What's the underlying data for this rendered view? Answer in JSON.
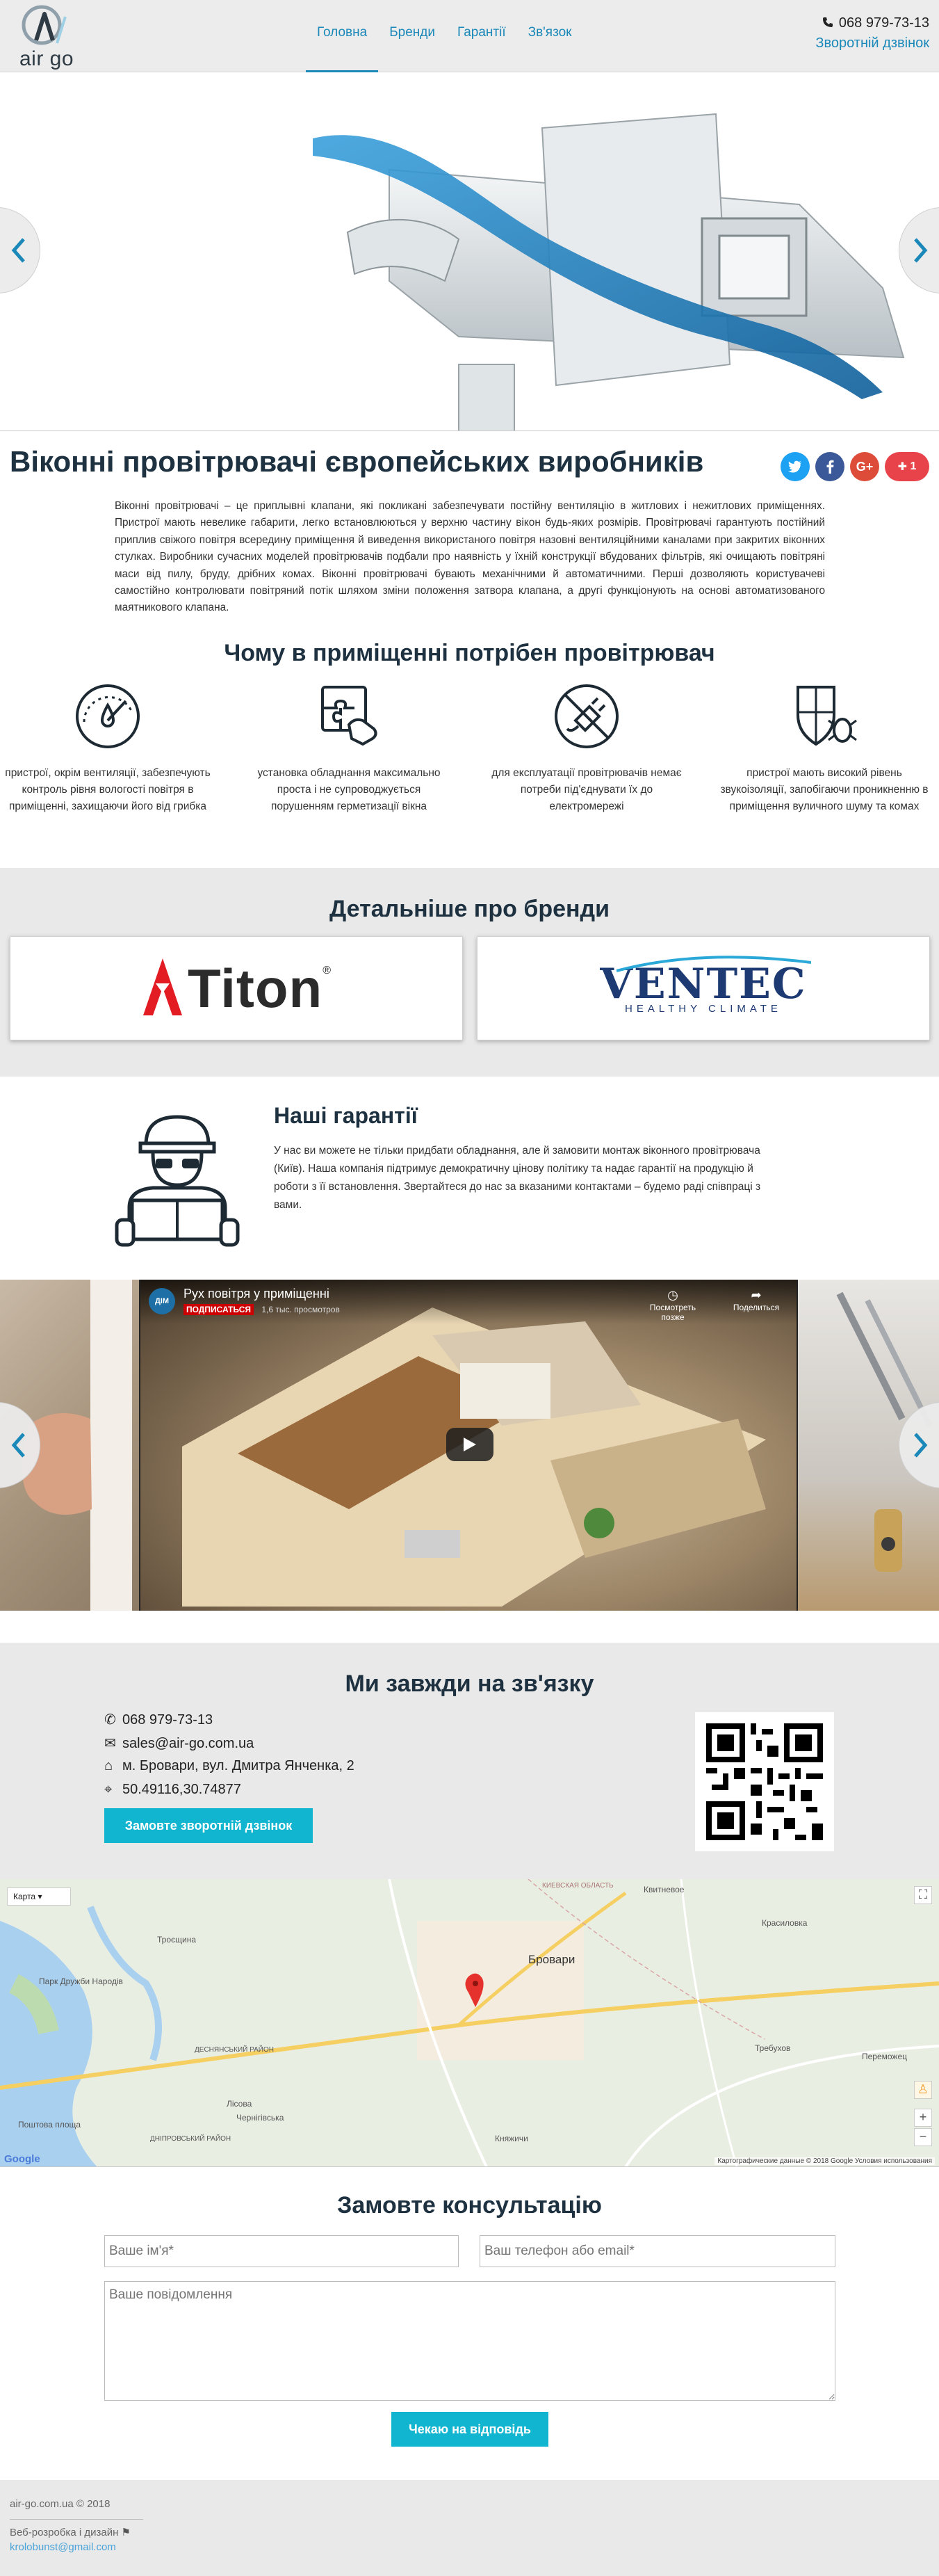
{
  "header": {
    "logo_text": "air go",
    "nav": [
      "Головна",
      "Бренди",
      "Гарантії",
      "Зв'язок"
    ],
    "phone": "068  979-73-13",
    "callback": "Зворотній дзвінок"
  },
  "page": {
    "title": "Віконні провітрювачі європейських виробників",
    "share_plus": "1",
    "intro": "Віконні провітрювачі – це приплывні клапани, які покликані забезпечувати постійну вентиляцію в житлових і нежитлових приміщеннях. Пристрої мають невелике габарити, легко встановлюються у верхню частину вікон будь-яких розмірів. Провітрювачі гарантують постійний приплив свіжого повітря всередину приміщення й виведення використаного повітря назовні вентиляційними каналами при закритих віконних стулках. Виробники сучасних моделей провітрювачів подбали про наявність у їхній конструкції вбудованих фільтрів, які очищають повітряні маси від пилу, бруду, дрібних комах. Віконні провітрювачі бувають механічними й автоматичними. Перші дозволяють користувачеві самостійно контролювати повітряний потік шляхом зміни положення затвора клапана, а другі функціонують на основі автоматизованого маятникового клапана."
  },
  "why": {
    "title": "Чому в приміщенні потрібен провітрювач",
    "items": [
      {
        "icon": "humidity-gauge-icon",
        "text": "пристрої, окрім вентиляції, забезпечують контроль рівня вологості повітря в приміщенні, захищаючи його від грибка"
      },
      {
        "icon": "puzzle-hand-icon",
        "text": "установка обладнання максимально проста і не супроводжується порушенням герметизації вікна"
      },
      {
        "icon": "no-electricity-icon",
        "text": "для експлуатації провітрювачів немає потреби під'єднувати їх до електромережі"
      },
      {
        "icon": "shield-bug-icon",
        "text": "пристрої мають високий рівень звукоізоляції, запобігаючи проникненню в приміщення вуличного шуму та комах"
      }
    ]
  },
  "brands": {
    "title": "Детальніше про бренди",
    "titon": "Titon",
    "ventec": "VENTEC",
    "ventec_sub": "HEALTHY CLIMATE"
  },
  "guarantees": {
    "title": "Наші гарантії",
    "text": "У нас ви можете не тільки придбати обладнання, але й замовити монтаж віконного провітрювача (Київ). Наша компанія підтримує демократичну цінову політику та надає гарантії на продукцію й роботи з її встановлення. Звертайтеся до нас за вказаними контактами – будемо раді співпраці з вами."
  },
  "video": {
    "title": "Рух повітря у приміщенні",
    "channel_avatar": "ДІМ",
    "subscribe": "ПОДПИСАТЬСЯ",
    "views": "1,6 тыс. просмотров",
    "watch_later": "Посмотреть позже",
    "share": "Поделиться"
  },
  "contacts": {
    "title": "Ми завжди на зв'язку",
    "phone": "068 979-73-13",
    "email": "sales@air-go.com.ua",
    "address": "м. Бровари, вул. Дмитра Янченка, 2",
    "coords": "50.49116,30.74877",
    "button": "Замовте зворотній дзвінок"
  },
  "map": {
    "type": "Карта",
    "city": "Бровари",
    "labels": [
      "Квитневое",
      "Красиловка",
      "Требухов",
      "Переможец",
      "Княжичи",
      "Троєщина",
      "Парк Дружби Народів",
      "Лісова",
      "Чернігівська",
      "ДНІПРОВСЬКИЙ РАЙОН",
      "ДЕСНЯНСЬКИЙ РАЙОН",
      "КИЕВСКАЯ ОБЛАСТЬ",
      "Поштова площа"
    ],
    "credit": "Картографические данные © 2018 Google   Условия использования",
    "google": "Google"
  },
  "form": {
    "title": "Замовте консультацію",
    "name_placeholder": "Ваше ім'я*",
    "contact_placeholder": "Ваш телефон або email*",
    "message_placeholder": "Ваше повідомлення",
    "submit": "Чекаю на відповідь"
  },
  "footer": {
    "copyright": "air-go.com.ua © 2018",
    "dev": "Веб-розробка і дизайн",
    "dev_email": "krolobunst@gmail.com"
  },
  "colors": {
    "accent": "#12b5cf",
    "link": "#1a88b8",
    "heading": "#1e3140",
    "bg_gray": "#e9e9e9"
  }
}
